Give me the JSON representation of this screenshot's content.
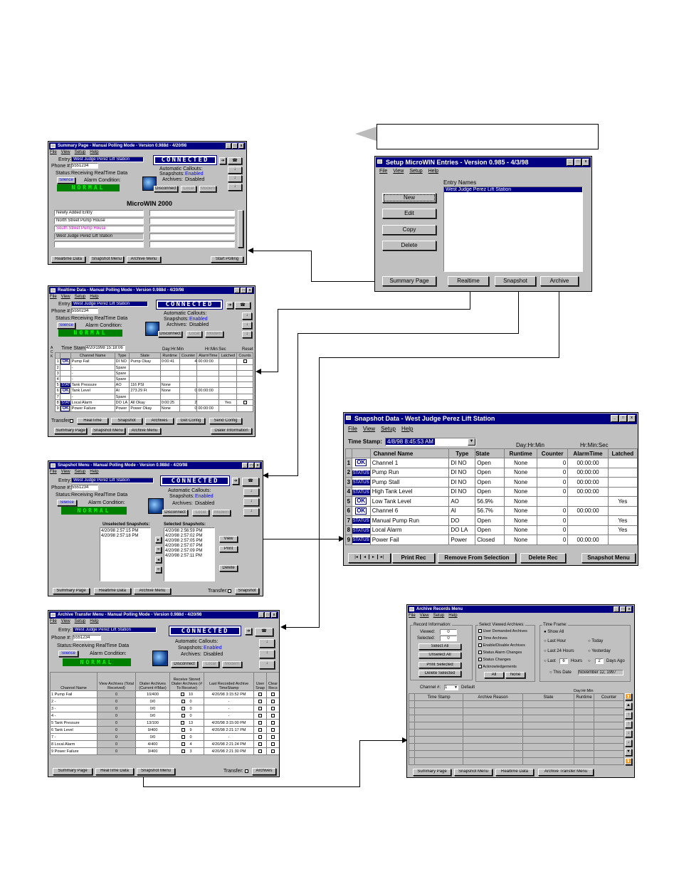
{
  "summary": {
    "title": "Summary Page - Manual Polling Mode - Version 0.988d - 4/20/98",
    "menu": [
      "File",
      "View",
      "Setup",
      "Help"
    ],
    "entry_label": "Entry:",
    "entry_value": "West Judge Perez Lift Station",
    "phone_label": "Phone #:",
    "phone_value": "5551234",
    "status_label": "Status:",
    "status_value": "Receiving RealTime Data",
    "silence": "Silence",
    "alarm_label": "Alarm Condition:",
    "normal": "NORMAL",
    "connected": "CONNECTED",
    "callouts_label": "Automatic Callouts:",
    "snapshots_label": "Snapshots:",
    "snapshots_value": "Enabled",
    "archives_label": "Archives:",
    "archives_value": "Disabled",
    "disconnect": "Disconnect",
    "local": "Local",
    "modem": "Modem",
    "heading": "MicroWIN 2000",
    "list": [
      "Newly Added Entry",
      "North Street Pump House",
      "South Street Pump House",
      "West Judge Perez Lift Station"
    ],
    "buttons": [
      "Realtime Data",
      "Snapshot Menu",
      "Archive Menu",
      "Start Polling"
    ]
  },
  "realtime": {
    "title": "Realtime Data - Manual Polling Mode - Version 0.988d - 4/20/98",
    "menu": [
      "File",
      "View",
      "Setup",
      "Help"
    ],
    "entry_value": "West Judge Perez Lift Station",
    "phone_value": "5550234",
    "status_value": "Receiving RealTime Data",
    "ack": "ACK",
    "timestamp_label": "Time Stamp:",
    "timestamp_value": "4/20/1998 15:18:06",
    "dayhr": "Day:Hr:Min",
    "hrmin": "Hr:Min:Sec",
    "reset": "Reset",
    "headers": [
      "Channel Name",
      "Type",
      "State",
      "Runtime",
      "Counter",
      "AlarmTime",
      "Latched",
      "Counts"
    ],
    "rows": [
      [
        "1",
        "OK",
        "Pump Fail",
        "DI NO",
        "Pump Okay",
        "0:00:41",
        "4",
        "00:00:00",
        ""
      ],
      [
        "2",
        "",
        "-",
        "Spare",
        "",
        "",
        "",
        "",
        ""
      ],
      [
        "3",
        "",
        "-",
        "Spare",
        "",
        "",
        "",
        "",
        ""
      ],
      [
        "4",
        "",
        "-",
        "Spare",
        "",
        "",
        "",
        "",
        ""
      ],
      [
        "5",
        "STATUS",
        "Tank Pressure",
        "AO",
        "116 PSI",
        "None",
        "",
        "",
        ""
      ],
      [
        "6",
        "OK",
        "Tank Level",
        "AI",
        "273.29 Ft",
        "None",
        "0",
        "00:00:00",
        ""
      ],
      [
        "7",
        "",
        "-",
        "Spare",
        "",
        "",
        "",
        "",
        ""
      ],
      [
        "8",
        "STATUS",
        "Local Alarm",
        "DO LA",
        "All Okay",
        "0:00:25",
        "2",
        "",
        "Yes"
      ],
      [
        "9",
        "OK",
        "Power Failure",
        "Power",
        "Power Okay",
        "None",
        "0",
        "00:00:00",
        ""
      ]
    ],
    "transfer": "Transfer:",
    "opts": [
      "RealTime",
      "Snapshot",
      "Archives",
      "Get Config",
      "Send Config"
    ],
    "buttons": [
      "Summary Page",
      "Snapshot Menu",
      "Archive Menu",
      "Dialer Information"
    ]
  },
  "snapmenu": {
    "title": "Snapshot Menu - Manual Polling Mode - Version 0.988d - 4/20/98",
    "menu": [
      "File",
      "View",
      "Setup",
      "Help"
    ],
    "entry_value": "West Judge Perez Lift Station",
    "phone_value": "5551234",
    "status_value": "Receiving RealTime Data",
    "unselected_label": "Unselected Snapshots:",
    "unselected": [
      "4/20/98 2:57:15 PM",
      "4/20/98 2:57:18 PM"
    ],
    "selected_label": "Selected Snapshots:",
    "selected": [
      "4/20/98 2:56:59 PM",
      "4/20/98 2:57:02 PM",
      "4/20/98 2:57:05 PM",
      "4/20/98 2:57:07 PM",
      "4/20/98 2:57:09 PM",
      "4/20/98 2:57:11 PM"
    ],
    "view": "View",
    "print": "Print",
    "delete": "Delete",
    "buttons": [
      "Summary Page",
      "Realtime Data",
      "Archive Menu",
      "Snapshot"
    ],
    "transfer": "Transfer:"
  },
  "archtrans": {
    "title": "Archive Transfer Menu - Manual Polling Mode - Version 0.988d - 4/20/98",
    "menu": [
      "File",
      "View",
      "Setup",
      "Help"
    ],
    "entry_value": "West Judge Perez Lift Station",
    "phone_value": "5551234",
    "status_value": "Receiving RealTime Data",
    "headers": [
      "Channel Name",
      "View Archives (Total Received)",
      "Dialer Archives (Current #/Max)",
      "Receive Stored Dialer Archives (# To Receive)",
      "Last Recorded Archive TimeStamp",
      "User Snap",
      "Clear Recs"
    ],
    "rows": [
      [
        "1 Pump Fail",
        "0",
        "10/400",
        "10",
        "4/20/98 3:15:52 PM"
      ],
      [
        "2 -",
        "0",
        "0/0",
        "0",
        "-"
      ],
      [
        "3 -",
        "0",
        "0/0",
        "0",
        "-"
      ],
      [
        "4 -",
        "0",
        "0/0",
        "0",
        "-"
      ],
      [
        "5 Tank Pressure",
        "0",
        "13/100",
        "13",
        "4/20/98 3:15:00 PM"
      ],
      [
        "6 Tank Level",
        "0",
        "9/400",
        "9",
        "4/20/98 2:21:17 PM"
      ],
      [
        "7 -",
        "0",
        "0/0",
        "0",
        "-"
      ],
      [
        "8 Local Alarm",
        "0",
        "4/400",
        "4",
        "4/20/98 2:21:24 PM"
      ],
      [
        "9 Power Failure",
        "0",
        "3/400",
        "3",
        "4/20/98 2:21:30 PM"
      ]
    ],
    "buttons": [
      "Summary Page",
      "RealTime Data",
      "Snapshot Menu",
      "Archives"
    ],
    "transfer": "Transfer:"
  },
  "setup": {
    "title": "Setup MicroWIN Entries - Version 0.985 - 4/3/98",
    "menu": [
      "File",
      "View",
      "Setup",
      "Help"
    ],
    "entry_names": "Entry Names",
    "entry": "West Judge Perez Lift Station",
    "side": [
      "New",
      "Edit",
      "Copy",
      "Delete"
    ],
    "bottom": [
      "Summary Page",
      "Realtime",
      "Snapshot",
      "Archive"
    ]
  },
  "snapdata": {
    "title": "Snapshot Data - West Judge Perez Lift Station",
    "menu": [
      "File",
      "View",
      "Setup",
      "Help"
    ],
    "timestamp_label": "Time Stamp:",
    "timestamp_value": "4/8/98 8:45:53 AM",
    "dayhr": "Day:Hr:Min",
    "hrmin": "Hr:Min:Sec",
    "headers": [
      "Channel Name",
      "Type",
      "State",
      "Runtime",
      "Counter",
      "AlarmTime",
      "Latched"
    ],
    "rows": [
      [
        "1",
        "OK",
        "Channel 1",
        "DI NO",
        "Open",
        "None",
        "0",
        "00:00:00",
        ""
      ],
      [
        "2",
        "STATUS",
        "Pump Run",
        "DI NO",
        "Open",
        "None",
        "0",
        "00:00:00",
        ""
      ],
      [
        "3",
        "STATUS",
        "Pump Stall",
        "DI NO",
        "Open",
        "None",
        "0",
        "00:00:00",
        ""
      ],
      [
        "4",
        "STATUS",
        "High Tank Level",
        "DI NO",
        "Open",
        "None",
        "0",
        "00:00:00",
        ""
      ],
      [
        "5",
        "OK",
        "Low Tank Level",
        "AO",
        "56.9%",
        "None",
        "",
        "",
        "Yes"
      ],
      [
        "6",
        "OK",
        "Channel 6",
        "AI",
        "56.7%",
        "None",
        "0",
        "00:00:00",
        ""
      ],
      [
        "7",
        "STATUS",
        "Manual Pump Run",
        "DO",
        "Open",
        "None",
        "0",
        "",
        "Yes"
      ],
      [
        "8",
        "STATUS",
        "Local Alarm",
        "DO LA",
        "Open",
        "None",
        "0",
        "",
        "Yes"
      ],
      [
        "9",
        "STATUS",
        "Power Fail",
        "Power",
        "Closed",
        "None",
        "0",
        "00:00:00",
        ""
      ]
    ],
    "buttons": [
      "Print Rec",
      "Remove From Selection",
      "Delete Rec",
      "Snapshot Menu"
    ]
  },
  "archrec": {
    "title": "Archive Records Menu",
    "menu": [
      "File",
      "View",
      "Setup",
      "Help"
    ],
    "record_info": "Record Information:",
    "viewed": "Viewed:",
    "viewed_value": "0",
    "selected": "Selected:",
    "selected_value": "0",
    "select_all": "Select All",
    "unselect_all": "Unselect All",
    "print_selected": "Print Selected",
    "delete_selected": "Delete Selected",
    "sva": "Select Viewed Archives:",
    "sva_items": [
      "User Demanded Archives",
      "Time Archives",
      "Enable/Disable Archives",
      "Status Alarm Changes",
      "Status Changes",
      "Acknowledgements"
    ],
    "all": "All",
    "none": "None",
    "tf": "Time Frame:",
    "show_all": "Show All",
    "last_hour": "Last Hour",
    "last24": "Last 24 Hours",
    "last": "Last",
    "last_val": "6",
    "hours": "Hours",
    "today": "Today",
    "yesterday": "Yesterday",
    "days_val": "2",
    "days_ago": "Days Ago",
    "this_date": "This Date",
    "date_val": "November 12, 1997",
    "channel_label": "Channel #:",
    "channel_val": "1",
    "default": "Default",
    "dayhr": "Day:Hr:Min",
    "headers": [
      "Time Stamp",
      "Archive Reason",
      "State",
      "Runtime",
      "Counter"
    ],
    "buttons": [
      "Summary Page",
      "Snapshot Menu",
      "Realtime Data",
      "Archive Transfer Menu"
    ]
  }
}
